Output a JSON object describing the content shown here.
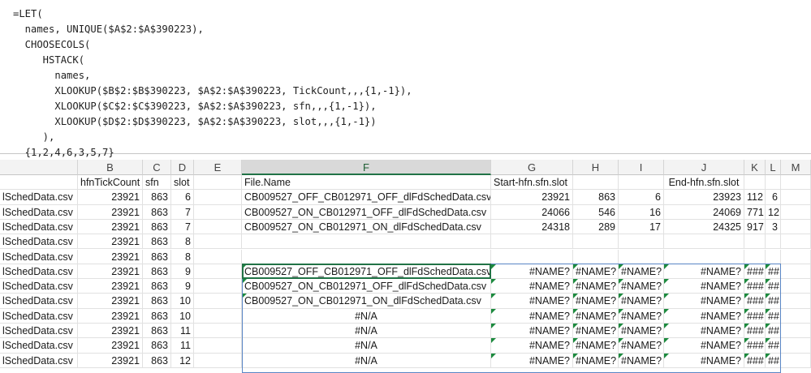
{
  "formula_lines": [
    "=LET(",
    "  names, UNIQUE($A$2:$A$390223),",
    "  CHOOSECOLS(",
    "     HSTACK(",
    "       names,",
    "       XLOOKUP($B$2:$B$390223, $A$2:$A$390223, TickCount,,,{1,-1}),",
    "       XLOOKUP($C$2:$C$390223, $A$2:$A$390223, sfn,,,{1,-1}),",
    "       XLOOKUP($D$2:$D$390223, $A$2:$A$390223, slot,,,{1,-1})",
    "     ),",
    "  {1,2,4,6,3,5,7}"
  ],
  "columns": [
    "B",
    "C",
    "D",
    "E",
    "F",
    "G",
    "H",
    "I",
    "J",
    "K",
    "L",
    "M"
  ],
  "selected_column": "F",
  "rows": [
    {
      "a": "",
      "b": "hfnTickCount",
      "c": "sfn",
      "d": "slot",
      "e": "",
      "f": "File.Name",
      "g": "Start-hfn.sfn.slot",
      "h": "",
      "i": "",
      "j": "End-hfn.sfn.slot",
      "k": "",
      "l": ""
    },
    {
      "a": "lSchedData.csv",
      "b": "23921",
      "c": "863",
      "d": "6",
      "e": "",
      "f": "CB009527_OFF_CB012971_OFF_dlFdSchedData.csv",
      "g": "23921",
      "h": "863",
      "i": "6",
      "j": "23923",
      "k": "112",
      "l": "6"
    },
    {
      "a": "lSchedData.csv",
      "b": "23921",
      "c": "863",
      "d": "7",
      "e": "",
      "f": "CB009527_ON_CB012971_OFF_dlFdSchedData.csv",
      "g": "24066",
      "h": "546",
      "i": "16",
      "j": "24069",
      "k": "771",
      "l": "12"
    },
    {
      "a": "lSchedData.csv",
      "b": "23921",
      "c": "863",
      "d": "7",
      "e": "",
      "f": "CB009527_ON_CB012971_ON_dlFdSchedData.csv",
      "g": "24318",
      "h": "289",
      "i": "17",
      "j": "24325",
      "k": "917",
      "l": "3"
    },
    {
      "a": "lSchedData.csv",
      "b": "23921",
      "c": "863",
      "d": "8",
      "e": "",
      "f": "",
      "g": "",
      "h": "",
      "i": "",
      "j": "",
      "k": "",
      "l": ""
    },
    {
      "a": "lSchedData.csv",
      "b": "23921",
      "c": "863",
      "d": "8",
      "e": "",
      "f": "",
      "g": "",
      "h": "",
      "i": "",
      "j": "",
      "k": "",
      "l": ""
    },
    {
      "a": "lSchedData.csv",
      "b": "23921",
      "c": "863",
      "d": "9",
      "e": "",
      "f": "CB009527_OFF_CB012971_OFF_dlFdSchedData.csv",
      "g": "#NAME?",
      "h": "#NAME?",
      "i": "#NAME?",
      "j": "#NAME?",
      "k": "###",
      "l": "##",
      "err": true
    },
    {
      "a": "lSchedData.csv",
      "b": "23921",
      "c": "863",
      "d": "9",
      "e": "",
      "f": "CB009527_ON_CB012971_OFF_dlFdSchedData.csv",
      "g": "#NAME?",
      "h": "#NAME?",
      "i": "#NAME?",
      "j": "#NAME?",
      "k": "###",
      "l": "##",
      "err": true
    },
    {
      "a": "lSchedData.csv",
      "b": "23921",
      "c": "863",
      "d": "10",
      "e": "",
      "f": "CB009527_ON_CB012971_ON_dlFdSchedData.csv",
      "g": "#NAME?",
      "h": "#NAME?",
      "i": "#NAME?",
      "j": "#NAME?",
      "k": "###",
      "l": "##",
      "err": true
    },
    {
      "a": "lSchedData.csv",
      "b": "23921",
      "c": "863",
      "d": "10",
      "e": "",
      "f": "#N/A",
      "g": "#NAME?",
      "h": "#NAME?",
      "i": "#NAME?",
      "j": "#NAME?",
      "k": "###",
      "l": "##",
      "err": true
    },
    {
      "a": "lSchedData.csv",
      "b": "23921",
      "c": "863",
      "d": "11",
      "e": "",
      "f": "#N/A",
      "g": "#NAME?",
      "h": "#NAME?",
      "i": "#NAME?",
      "j": "#NAME?",
      "k": "###",
      "l": "##",
      "err": true
    },
    {
      "a": "lSchedData.csv",
      "b": "23921",
      "c": "863",
      "d": "11",
      "e": "",
      "f": "#N/A",
      "g": "#NAME?",
      "h": "#NAME?",
      "i": "#NAME?",
      "j": "#NAME?",
      "k": "###",
      "l": "##",
      "err": true
    },
    {
      "a": "lSchedData.csv",
      "b": "23921",
      "c": "863",
      "d": "12",
      "e": "",
      "f": "#N/A",
      "g": "#NAME?",
      "h": "#NAME?",
      "i": "#NAME?",
      "j": "#NAME?",
      "k": "###",
      "l": "##",
      "err": true
    }
  ]
}
